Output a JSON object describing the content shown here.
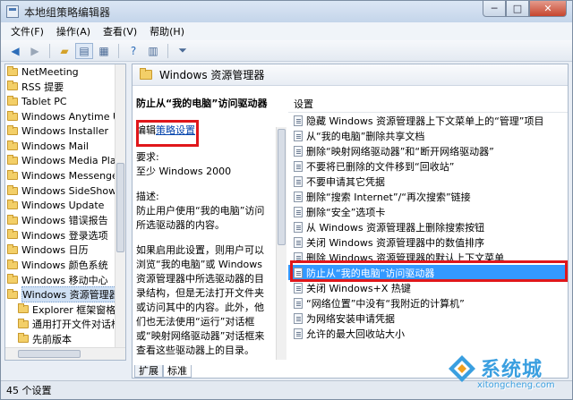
{
  "window": {
    "title": "本地组策略编辑器"
  },
  "window_buttons": {
    "minimize": "─",
    "maximize": "□",
    "close": "✕"
  },
  "menu": [
    "文件(F)",
    "操作(A)",
    "查看(V)",
    "帮助(H)"
  ],
  "toolbar": {
    "icons": [
      "back-icon",
      "forward-icon",
      "up-folder-icon",
      "show-hide-tree-icon",
      "export-list-icon",
      "help-icon",
      "properties-icon",
      "filter-icon"
    ]
  },
  "tree": {
    "items": [
      {
        "label": "NetMeeting",
        "sub": false
      },
      {
        "label": "RSS 提要",
        "sub": false
      },
      {
        "label": "Tablet PC",
        "sub": false
      },
      {
        "label": "Windows Anytime Upg",
        "sub": false
      },
      {
        "label": "Windows Installer",
        "sub": false
      },
      {
        "label": "Windows Mail",
        "sub": false
      },
      {
        "label": "Windows Media Playe",
        "sub": false
      },
      {
        "label": "Windows Messenger",
        "sub": false
      },
      {
        "label": "Windows SideShow",
        "sub": false
      },
      {
        "label": "Windows Update",
        "sub": false
      },
      {
        "label": "Windows 错误报告",
        "sub": false
      },
      {
        "label": "Windows 登录选项",
        "sub": false
      },
      {
        "label": "Windows 日历",
        "sub": false
      },
      {
        "label": "Windows 颜色系统",
        "sub": false
      },
      {
        "label": "Windows 移动中心",
        "sub": false
      },
      {
        "label": "Windows 资源管理器",
        "sub": false,
        "selected": true
      },
      {
        "label": "Explorer 框架窗格",
        "sub": true
      },
      {
        "label": "通用打开文件对话框",
        "sub": true
      },
      {
        "label": "先前版本",
        "sub": true
      },
      {
        "label": "备份",
        "sub": false
      }
    ]
  },
  "right": {
    "header_title": "Windows 资源管理器",
    "description": {
      "title": "防止从“我的电脑”访问驱动器",
      "edit_prefix": "编辑",
      "edit_link": "策略设置",
      "req_label": "要求:",
      "req_value": "至少 Windows 2000",
      "desc_label": "描述:",
      "desc_text": "防止用户使用“我的电脑”访问所选驱动器的内容。",
      "more_text": "如果启用此设置，则用户可以浏览“我的电脑”或 Windows 资源管理器中所选驱动器的目录结构，但是无法打开文件夹或访问其中的内容。此外，他们也无法使用“运行”对话框或“映射网络驱动器”对话框来查看这些驱动器上的目录。"
    },
    "settings_header": "设置",
    "settings": [
      "隐藏 Windows 资源管理器上下文菜单上的“管理”项目",
      "从“我的电脑”删除共享文档",
      "删除“映射网络驱动器”和“断开网络驱动器”",
      "不要将已删除的文件移到“回收站”",
      "不要申请其它凭据",
      "删除“搜索 Internet”/“再次搜索”链接",
      "删除“安全”选项卡",
      "从 Windows 资源管理器上删除搜索按钮",
      "关闭 Windows 资源管理器中的数值排序",
      "删除 Windows 资源管理器的默认上下文菜单",
      "防止从“我的电脑”访问驱动器",
      "关闭 Windows+X 热键",
      "“网络位置”中没有“我附近的计算机”",
      "为网络安装申请凭据",
      "允许的最大回收站大小"
    ],
    "selected_index": 10,
    "tabs": [
      "扩展",
      "标准"
    ]
  },
  "status": {
    "text": "45 个设置"
  },
  "watermark": {
    "brand": "系统城",
    "url": "xitongcheng.com"
  },
  "colors": {
    "highlight": "#3399ff",
    "annotation": "#e0171b",
    "watermark": "#3a9fe0"
  }
}
